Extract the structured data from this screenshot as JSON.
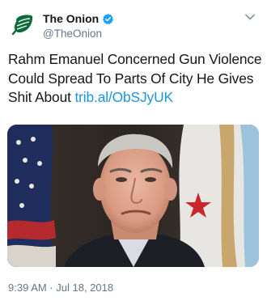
{
  "account": {
    "display_name": "The Onion",
    "handle": "@TheOnion",
    "avatar_icon": "onion-logo-icon",
    "verified_icon": "verified-badge-icon",
    "brand_color": "#0e6b3b",
    "verified_color": "#1da1f2"
  },
  "tweet": {
    "text": "Rahm Emanuel Concerned Gun Violence Could Spread To Parts Of City He Gives Shit About ",
    "link_text": "trib.al/ObSJyUK",
    "link_color": "#1b95e0",
    "media_description_icon": "tweet-photo",
    "timestamp": "9:39 AM · Jul 18, 2018"
  },
  "menu": {
    "icon": "chevron-down-icon"
  }
}
